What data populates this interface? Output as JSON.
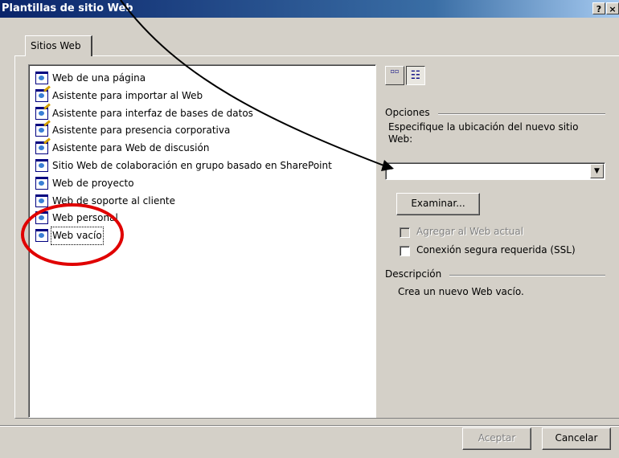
{
  "window": {
    "title": "Plantillas de sitio Web",
    "help_glyph": "?",
    "close_glyph": "×"
  },
  "tabs": [
    {
      "label": "Sitios Web",
      "selected": true
    }
  ],
  "templates": [
    {
      "label": "Web de una página",
      "icon": "web-page-icon"
    },
    {
      "label": "Asistente para importar al Web",
      "icon": "wizard-icon"
    },
    {
      "label": "Asistente para interfaz de bases de datos",
      "icon": "wizard-icon"
    },
    {
      "label": "Asistente para presencia corporativa",
      "icon": "wizard-icon"
    },
    {
      "label": "Asistente para Web de discusión",
      "icon": "wizard-icon"
    },
    {
      "label": "Sitio Web de colaboración en grupo basado en SharePoint",
      "icon": "web-page-icon"
    },
    {
      "label": "Web de proyecto",
      "icon": "web-page-icon"
    },
    {
      "label": "Web de soporte al cliente",
      "icon": "web-page-icon"
    },
    {
      "label": "Web personal",
      "icon": "web-page-icon"
    },
    {
      "label": "Web vacío",
      "icon": "web-page-icon",
      "selected": true
    }
  ],
  "view_buttons": {
    "large_icons_glyph": "▫▫",
    "list_glyph": "☷"
  },
  "options": {
    "group_label": "Opciones",
    "location_label_part1": "Especifique la ubicación del nuevo sitio",
    "location_label_part2": "Web:",
    "location_value": "",
    "browse_button": "Examinar...",
    "add_to_current_web": "Agregar al Web actual",
    "add_to_current_web_checked": false,
    "add_to_current_web_enabled": false,
    "secure_connection": "Conexión segura requerida (SSL)",
    "secure_connection_checked": false
  },
  "description": {
    "group_label": "Descripción",
    "text": "Crea un nuevo Web vacío."
  },
  "buttons": {
    "ok": "Aceptar",
    "ok_enabled": false,
    "cancel": "Cancelar"
  },
  "annotation": {
    "arrow_color": "#000000",
    "circle_color": "#e00000"
  }
}
